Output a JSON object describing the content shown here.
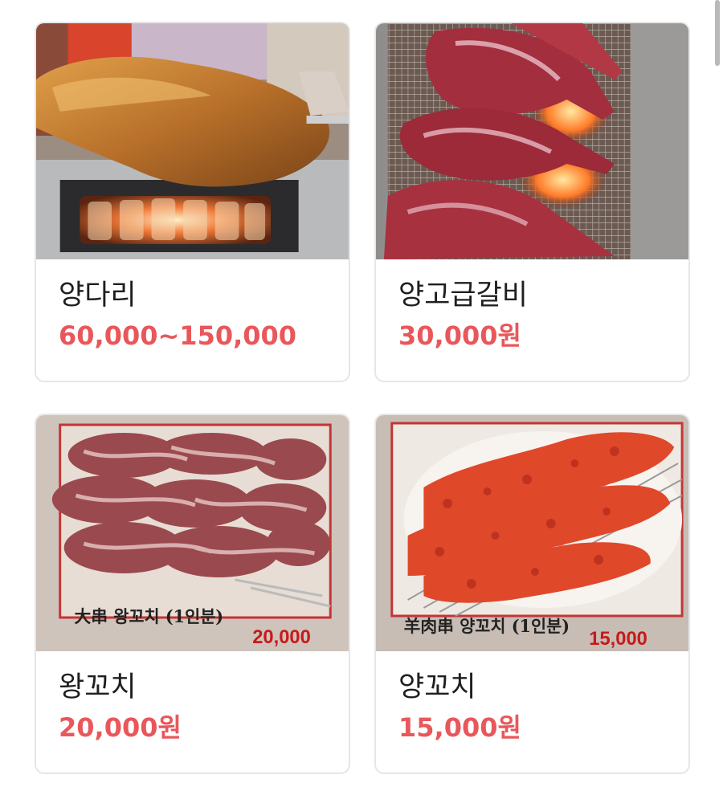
{
  "menu": {
    "items": [
      {
        "name": "양다리",
        "price": "60,000~150,000",
        "photo": "roast-lamb-leg-on-grill"
      },
      {
        "name": "양고급갈비",
        "price": "30,000원",
        "photo": "raw-lamb-ribs-on-grill"
      },
      {
        "name": "왕꼬치",
        "price": "20,000원",
        "photo": "large-lamb-skewers",
        "photo_caption": "大串 왕꼬치 (1인분)",
        "photo_price": "20,000"
      },
      {
        "name": "양꼬치",
        "price": "15,000원",
        "photo": "spiced-lamb-skewers",
        "photo_caption": "羊肉串 양꼬치 (1인분)",
        "photo_price": "15,000"
      }
    ]
  },
  "colors": {
    "price": "#e9575b",
    "name": "#1f1f1f",
    "card_border": "#e6e6e6"
  }
}
